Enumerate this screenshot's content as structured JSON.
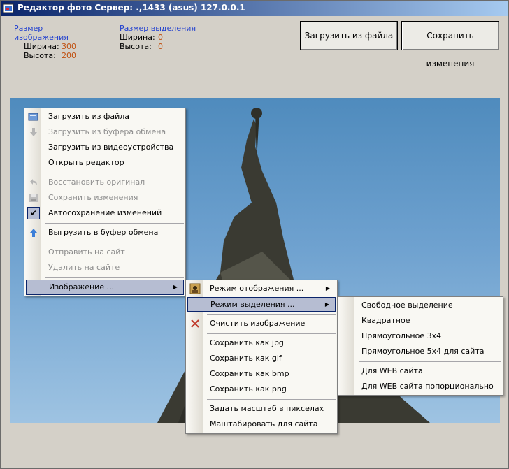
{
  "window": {
    "title": "Редактор фото  Сервер: .,1433 (asus) 127.0.0.1"
  },
  "image_size": {
    "header": "Размер изображения",
    "width_label": "Ширина:",
    "width_value": "300",
    "height_label": "Высота:",
    "height_value": "200"
  },
  "selection_size": {
    "header": "Размер выделения",
    "width_label": "Ширина:",
    "width_value": "0",
    "height_label": "Высота:",
    "height_value": "0"
  },
  "buttons": {
    "load": "Загрузить из файла",
    "save": "Сохранить изменения"
  },
  "context_menu": {
    "items": [
      {
        "label": "Загрузить из файла",
        "enabled": true,
        "icon": "open-file-icon"
      },
      {
        "label": "Загрузить из буфера обмена",
        "enabled": false,
        "icon": "down-arrow-icon"
      },
      {
        "label": "Загрузить из видеоустройства",
        "enabled": true
      },
      {
        "label": "Открыть редактор",
        "enabled": true
      },
      {
        "label": "Восстановить оригинал",
        "enabled": false,
        "icon": "undo-icon"
      },
      {
        "label": "Сохранить изменения",
        "enabled": false,
        "icon": "save-icon"
      },
      {
        "label": "Автосохранение изменений",
        "enabled": true,
        "checked": true
      },
      {
        "label": "Выгрузить в буфер обмена",
        "enabled": true,
        "icon": "up-arrow-icon"
      },
      {
        "label": "Отправить на сайт",
        "enabled": false
      },
      {
        "label": "Удалить на сайте",
        "enabled": false
      },
      {
        "label": "Изображение ...",
        "enabled": true,
        "submenu": true,
        "selected": true
      }
    ]
  },
  "image_submenu": {
    "items": [
      {
        "label": "Режим отображения ...",
        "submenu": true,
        "icon": "display-mode-icon"
      },
      {
        "label": "Режим выделения ...",
        "submenu": true,
        "selected": true
      },
      {
        "label": "Очистить изображение",
        "icon": "clear-icon"
      },
      {
        "label": "Сохранить как jpg"
      },
      {
        "label": "Сохранить как gif"
      },
      {
        "label": "Сохранить как bmp"
      },
      {
        "label": "Сохранить как png"
      },
      {
        "label": "Задать масштаб в пикселах"
      },
      {
        "label": "Маштабировать для сайта"
      }
    ]
  },
  "selection_submenu": {
    "items": [
      {
        "label": "Свободное выделение"
      },
      {
        "label": "Квадратное"
      },
      {
        "label": "Прямоугольное 3x4"
      },
      {
        "label": "Прямоугольное 5x4 для сайта"
      },
      {
        "label": "Для WEB сайта"
      },
      {
        "label": "Для WEB сайта попорционально"
      }
    ]
  }
}
